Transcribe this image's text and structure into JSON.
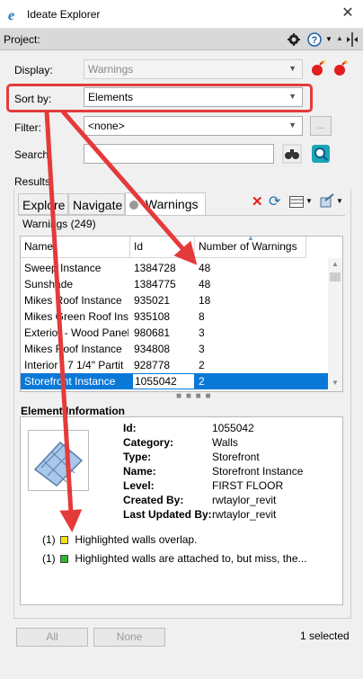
{
  "window": {
    "title": "Ideate Explorer",
    "close": "✕"
  },
  "project": {
    "label": "Project:"
  },
  "display": {
    "label": "Display:",
    "value": "Warnings"
  },
  "sort": {
    "label": "Sort by:",
    "value": "Elements"
  },
  "filter": {
    "label": "Filter:",
    "value": "<none>",
    "button": "..."
  },
  "search": {
    "label": "Search:",
    "value": ""
  },
  "results": {
    "label": "Results",
    "tabs": [
      "Explore",
      "Navigate",
      "Warnings"
    ],
    "warnings_count": "Warnings (249)",
    "columns": [
      "Name",
      "Id",
      "Number of Warnings"
    ],
    "rows": [
      {
        "name": "Sweep Instance",
        "id": "1384728",
        "count": "48"
      },
      {
        "name": "Sunshade",
        "id": "1384775",
        "count": "48"
      },
      {
        "name": "Mikes Roof Instance",
        "id": "935021",
        "count": "18"
      },
      {
        "name": "Mikes Green Roof Inst",
        "id": "935108",
        "count": "8"
      },
      {
        "name": "Exterior - Wood Panel",
        "id": "980681",
        "count": "3"
      },
      {
        "name": "Mikes Roof Instance",
        "id": "934808",
        "count": "3"
      },
      {
        "name": "Interior - 7 1/4\" Partit",
        "id": "928778",
        "count": "2"
      },
      {
        "name": "Storefront Instance",
        "id": "1055042",
        "count": "2"
      }
    ]
  },
  "element_info": {
    "title": "Element Information",
    "fields": [
      {
        "key": "Id:",
        "value": "1055042"
      },
      {
        "key": "Category:",
        "value": "Walls"
      },
      {
        "key": "Type:",
        "value": "Storefront"
      },
      {
        "key": "Name:",
        "value": "Storefront Instance"
      },
      {
        "key": "Level:",
        "value": "FIRST FLOOR"
      },
      {
        "key": "Created  By:",
        "value": "rwtaylor_revit"
      },
      {
        "key": "Last Updated By:",
        "value": "rwtaylor_revit"
      }
    ],
    "warnings": [
      {
        "count": "(1)",
        "color": "#f5e400",
        "text": "Highlighted walls overlap."
      },
      {
        "count": "(1)",
        "color": "#2db82d",
        "text": "Highlighted walls are attached to, but miss, the..."
      }
    ]
  },
  "footer": {
    "all": "All",
    "none": "None",
    "status": "1 selected"
  },
  "colors": {
    "selection": "#0a78d7",
    "annotation": "#e53a3a"
  }
}
